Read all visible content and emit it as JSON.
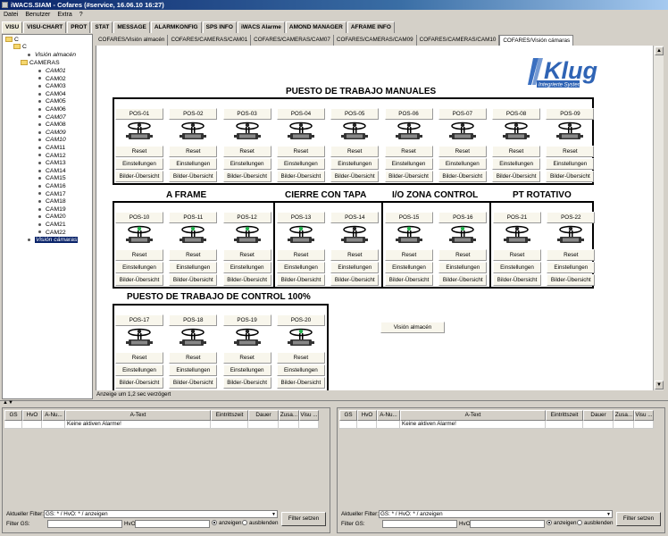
{
  "window": {
    "title": "iWACS.SIAM - Cofares (#service, 16.06.10 16:27)"
  },
  "menu": [
    "Datei",
    "Benutzer",
    "Extra",
    "?"
  ],
  "tabs": [
    "VISU",
    "VISU-CHART",
    "PROT",
    "STAT",
    "MESSAGE",
    "ALARMKONFIG",
    "SPS INFO",
    "iWACS Alarme",
    "AMOND MANAGER",
    "AFRAME INFO"
  ],
  "active_tab": "VISU",
  "tree": {
    "root": "C",
    "child": "C",
    "vision_almacen": "Visión almacén",
    "cameras": "CAMERAS",
    "cams": [
      "CAM01",
      "CAM02",
      "CAM03",
      "CAM04",
      "CAM05",
      "CAM06",
      "CAM07",
      "CAM08",
      "CAM09",
      "CAM10",
      "CAM11",
      "CAM12",
      "CAM13",
      "CAM14",
      "CAM15",
      "CAM16",
      "CAM17",
      "CAM18",
      "CAM19",
      "CAM20",
      "CAM21",
      "CAM22"
    ],
    "italic_cams": [
      "CAM01",
      "CAM07",
      "CAM09",
      "CAM10"
    ],
    "vision_camaras": "Visión cámaras"
  },
  "subtabs": [
    "COFARES/Visión almacén",
    "COFARES/CAMERAS/CAM01",
    "COFARES/CAMERAS/CAM07",
    "COFARES/CAMERAS/CAM09",
    "COFARES/CAMERAS/CAM10",
    "COFARES/Visión cámaras"
  ],
  "logo": {
    "text": "Klug",
    "subtitle": "Integrierte Systeme"
  },
  "buttons": {
    "reset": "Reset",
    "settings": "Einstellungen",
    "images": "Bilder-Übersicht"
  },
  "groups": [
    {
      "title": "PUESTO DE TRABAJO MANUALES",
      "positions": [
        {
          "name": "POS-01",
          "active": false
        },
        {
          "name": "POS-02",
          "active": false
        },
        {
          "name": "POS-03",
          "active": false
        },
        {
          "name": "POS-04",
          "active": false
        },
        {
          "name": "POS-05",
          "active": false
        },
        {
          "name": "POS-06",
          "active": false
        },
        {
          "name": "POS-07",
          "active": false
        },
        {
          "name": "POS-08",
          "active": false
        },
        {
          "name": "POS-09",
          "active": false
        }
      ]
    },
    {
      "title": "A  FRAME",
      "positions": [
        {
          "name": "POS-10",
          "active": true
        },
        {
          "name": "POS-11",
          "active": true
        },
        {
          "name": "POS-12",
          "active": true
        }
      ]
    },
    {
      "title": "CIERRE CON TAPA",
      "positions": [
        {
          "name": "POS-13",
          "active": true
        },
        {
          "name": "POS-14",
          "active": false
        }
      ]
    },
    {
      "title": "I/O ZONA CONTROL",
      "positions": [
        {
          "name": "POS-15",
          "active": true
        },
        {
          "name": "POS-16",
          "active": true
        }
      ]
    },
    {
      "title": "PT ROTATIVO",
      "positions": [
        {
          "name": "POS-21",
          "active": false
        },
        {
          "name": "POS-22",
          "active": false
        }
      ]
    },
    {
      "title": "PUESTO DE TRABAJO DE CONTROL 100%",
      "positions": [
        {
          "name": "POS-17",
          "active": false
        },
        {
          "name": "POS-18",
          "active": false
        },
        {
          "name": "POS-19",
          "active": false
        },
        {
          "name": "POS-20",
          "active": true
        }
      ]
    }
  ],
  "vision_almacen_button": "Visión almacén",
  "status": "Anzeige um 1,2 sec verzögert",
  "colors": {
    "active_light": "#22b14c",
    "inactive_light": "#222222",
    "title_bar": "#0a246a"
  },
  "alarm_panels": [
    {
      "columns": [
        "GS",
        "HvO",
        "A-Nu...",
        "A-Text",
        "Eintrittszeit",
        "Dauer",
        "Zusa...",
        "Visu ..."
      ],
      "rows": [
        [
          "",
          "",
          "",
          "Keine aktiven Alarme!",
          "",
          "",
          "",
          ""
        ]
      ],
      "filter_label": "Aktueller Filter:",
      "filter_value": "GS: * / HvO: * / anzeigen",
      "gs_label": "Filter GS:",
      "hvo_label": "HvO",
      "show": "anzeigen",
      "hide": "ausblenden",
      "set_button": "Filter setzen"
    },
    {
      "columns": [
        "GS",
        "HvO",
        "A-Nu...",
        "A-Text",
        "Eintrittszeit",
        "Dauer",
        "Zusa...",
        "Visu ..."
      ],
      "rows": [
        [
          "",
          "",
          "",
          "Keine aktiven Alarme!",
          "",
          "",
          "",
          ""
        ]
      ],
      "filter_label": "Aktueller Filter:",
      "filter_value": "GS: * / HvO: * / anzeigen",
      "gs_label": "Filter GS:",
      "hvo_label": "HvO",
      "show": "anzeigen",
      "hide": "ausblenden",
      "set_button": "Filter setzen"
    }
  ]
}
